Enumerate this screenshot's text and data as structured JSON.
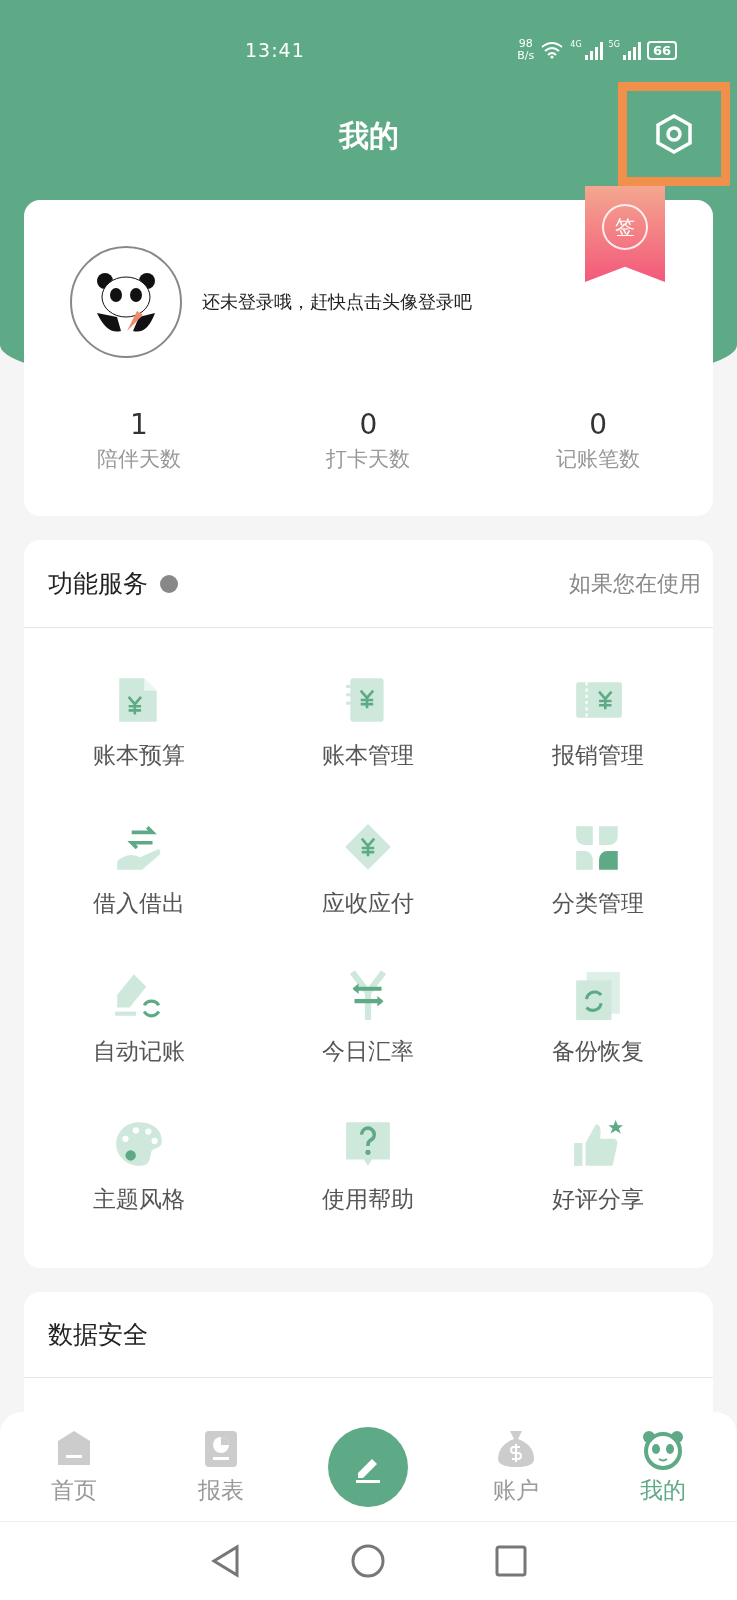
{
  "status_bar": {
    "time": "13:41",
    "net_speed": [
      "98",
      "B/s"
    ],
    "signals": [
      "4G",
      "5G"
    ],
    "battery": "66"
  },
  "header": {
    "title": "我的",
    "highlighted_settings": true
  },
  "profile": {
    "checkin_badge": "签",
    "login_prompt": "还未登录哦，赶快点击头像登录吧",
    "stats": [
      {
        "value": "1",
        "label": "陪伴天数"
      },
      {
        "value": "0",
        "label": "打卡天数"
      },
      {
        "value": "0",
        "label": "记账笔数"
      }
    ]
  },
  "services": {
    "title": "功能服务",
    "notice": "如果您在使用",
    "items": [
      {
        "label": "账本预算"
      },
      {
        "label": "账本管理"
      },
      {
        "label": "报销管理"
      },
      {
        "label": "借入借出"
      },
      {
        "label": "应收应付"
      },
      {
        "label": "分类管理"
      },
      {
        "label": "自动记账"
      },
      {
        "label": "今日汇率"
      },
      {
        "label": "备份恢复"
      },
      {
        "label": "主题风格"
      },
      {
        "label": "使用帮助"
      },
      {
        "label": "好评分享"
      }
    ]
  },
  "data_security": {
    "title": "数据安全"
  },
  "tab_bar": [
    {
      "kind": "tab",
      "label": "首页",
      "selected": false
    },
    {
      "kind": "tab",
      "label": "报表",
      "selected": false
    },
    {
      "kind": "compose"
    },
    {
      "kind": "tab",
      "label": "账户",
      "selected": false
    },
    {
      "kind": "tab",
      "label": "我的",
      "selected": true
    }
  ]
}
